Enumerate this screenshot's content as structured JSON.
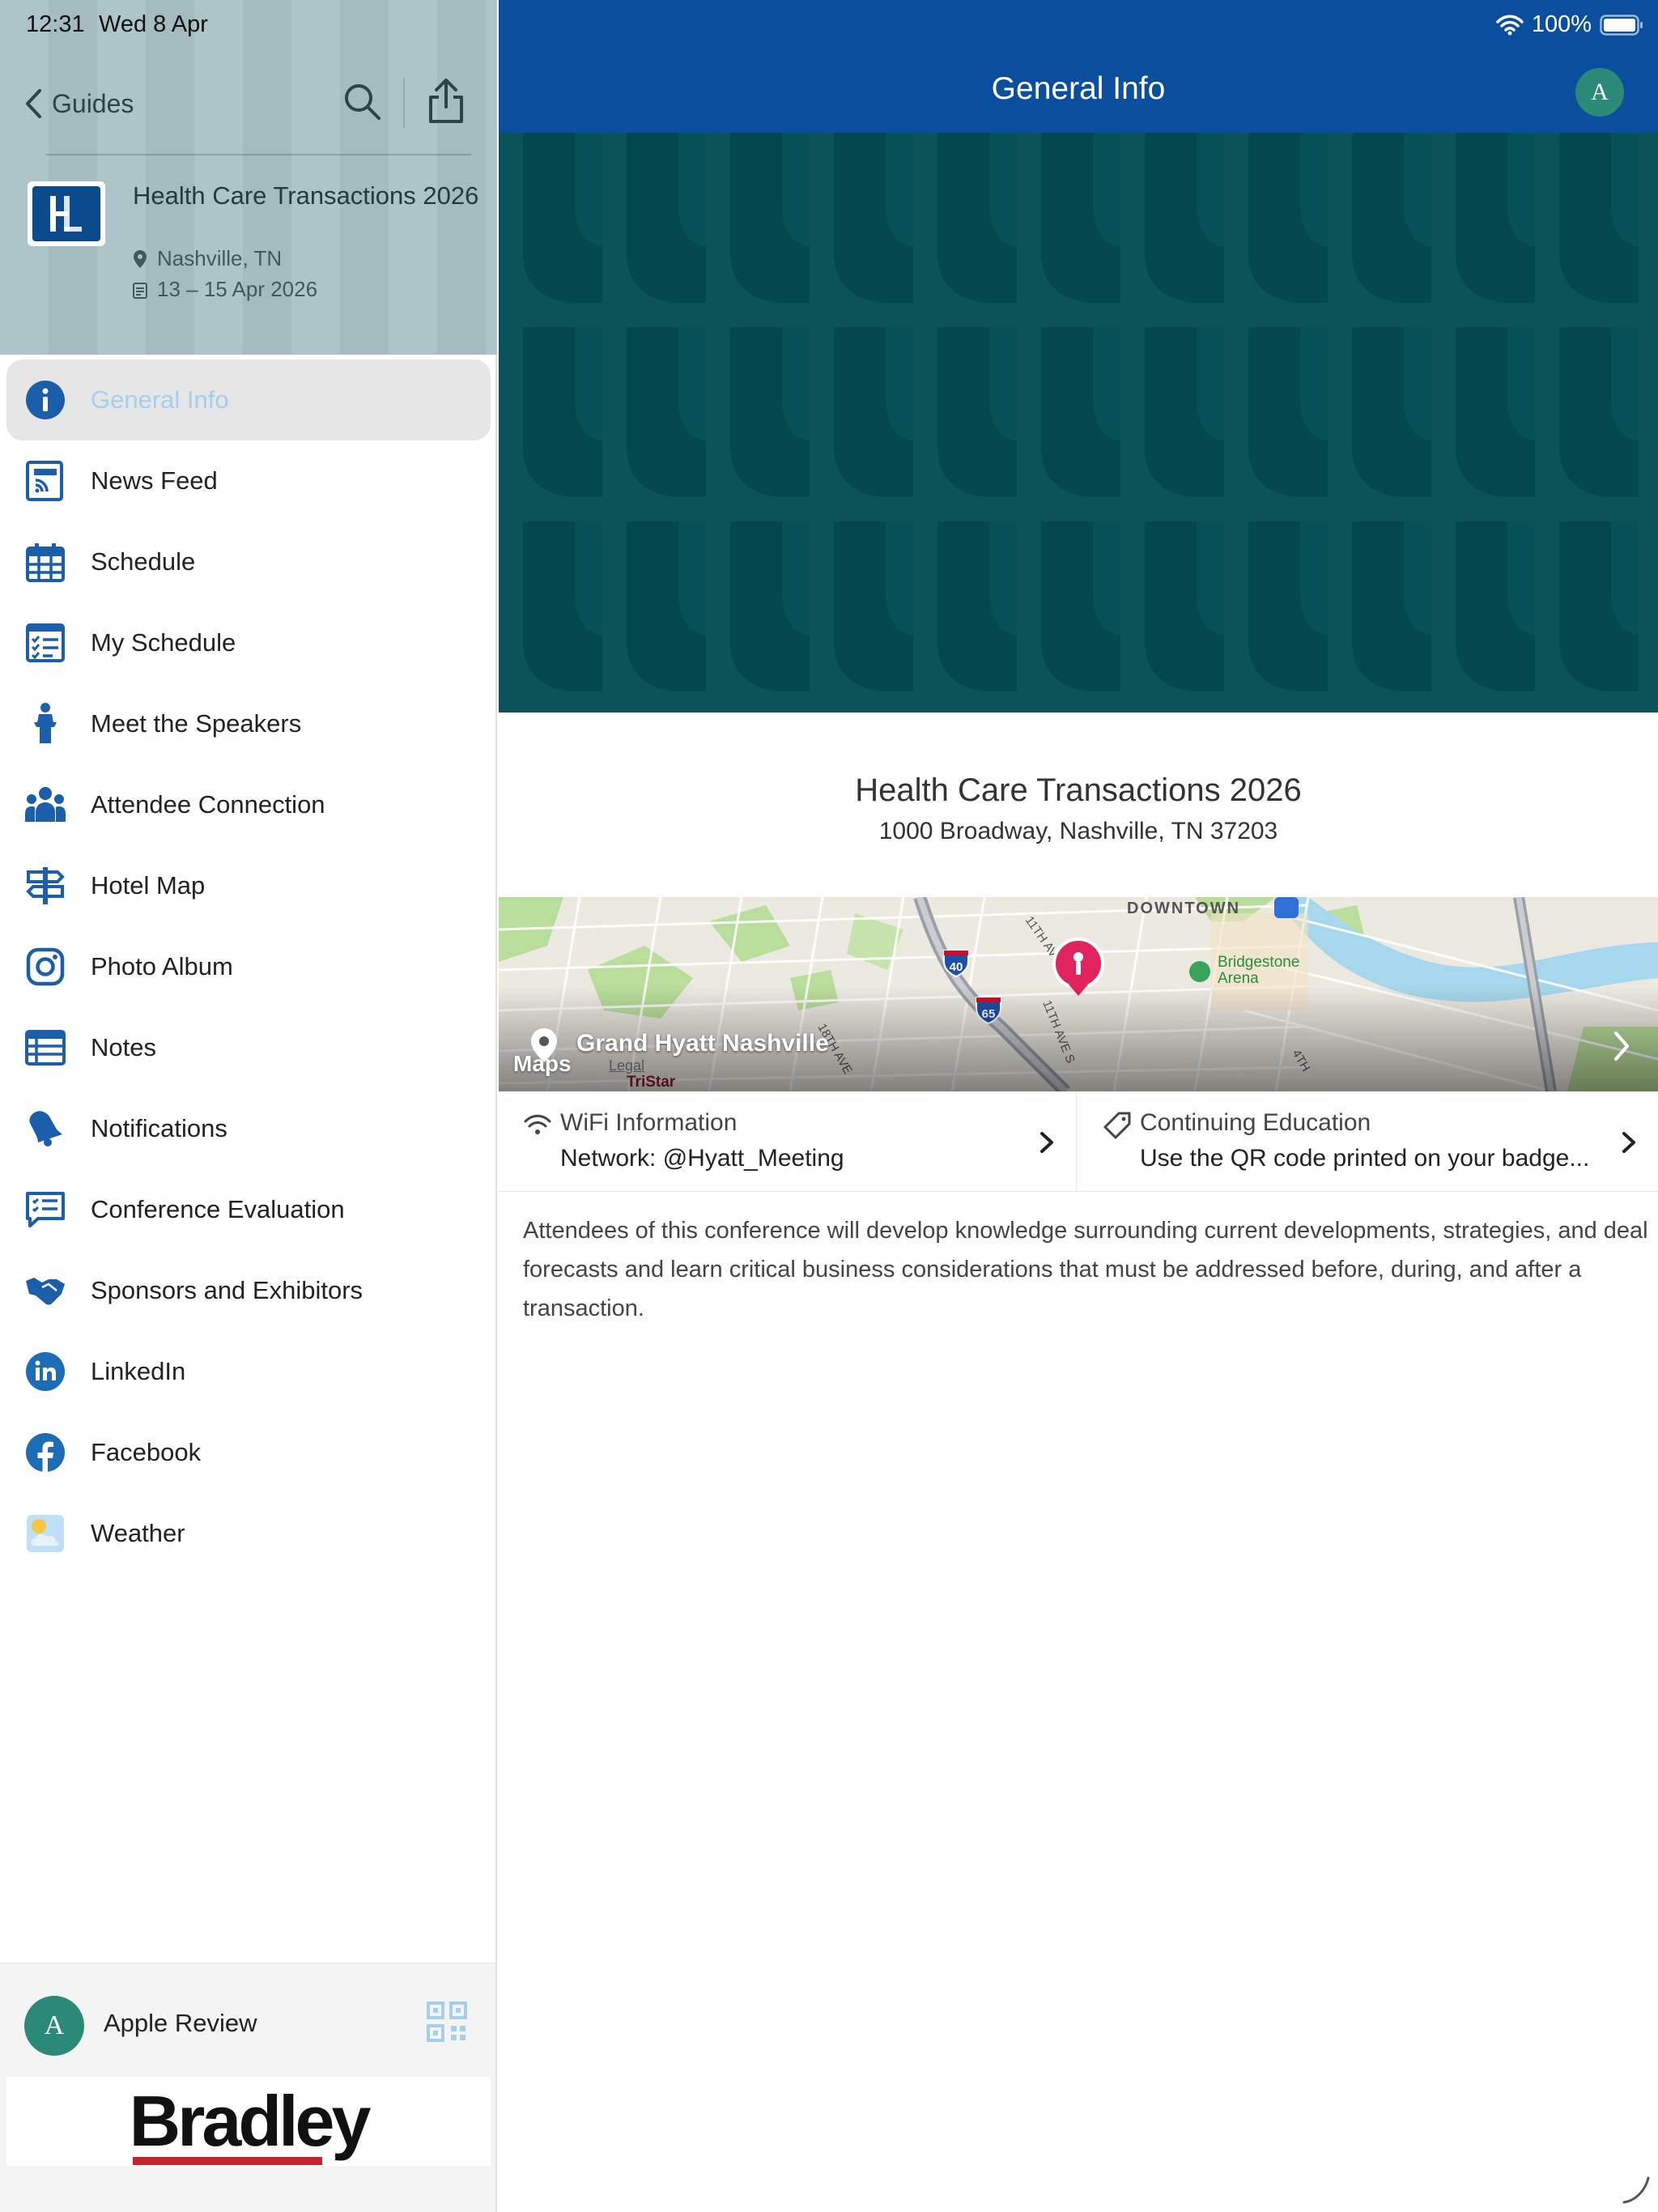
{
  "status_bar": {
    "time": "12:31",
    "date": "Wed 8 Apr",
    "battery": "100%"
  },
  "sidebar": {
    "back_label": "Guides",
    "event": {
      "title": "Health Care Transactions 2026",
      "location": "Nashville, TN",
      "dates": "13 – 15 Apr 2026",
      "logo_text": "HL"
    },
    "items": [
      {
        "label": "General Info",
        "icon": "info-icon",
        "active": true
      },
      {
        "label": "News Feed",
        "icon": "news-feed-icon"
      },
      {
        "label": "Schedule",
        "icon": "calendar-icon"
      },
      {
        "label": "My Schedule",
        "icon": "checklist-icon"
      },
      {
        "label": "Meet the Speakers",
        "icon": "speaker-podium-icon"
      },
      {
        "label": "Attendee Connection",
        "icon": "people-icon"
      },
      {
        "label": "Hotel Map",
        "icon": "signpost-icon"
      },
      {
        "label": "Photo Album",
        "icon": "instagram-icon"
      },
      {
        "label": "Notes",
        "icon": "notes-icon"
      },
      {
        "label": "Notifications",
        "icon": "bell-icon"
      },
      {
        "label": "Conference Evaluation",
        "icon": "evaluation-icon"
      },
      {
        "label": "Sponsors and Exhibitors",
        "icon": "handshake-icon"
      },
      {
        "label": "LinkedIn",
        "icon": "linkedin-icon"
      },
      {
        "label": "Facebook",
        "icon": "facebook-icon"
      },
      {
        "label": "Weather",
        "icon": "weather-icon"
      }
    ],
    "footer": {
      "user_initial": "A",
      "user_name": "Apple Review",
      "sponsor": "Bradley"
    }
  },
  "main": {
    "title": "General Info",
    "profile_initial": "A",
    "event_name": "Health Care Transactions 2026",
    "address": "1000 Broadway, Nashville, TN 37203",
    "map": {
      "venue": "Grand Hyatt Nashville",
      "credit": "Maps",
      "legal": "Legal",
      "labels": [
        "DOWNTOWN",
        "Bridgestone",
        "Arena",
        "11TH AVE N",
        "11TH AVE S",
        "18TH AVE",
        "4TH",
        "TriStar",
        "40",
        "65"
      ]
    },
    "wifi": {
      "title": "WiFi Information",
      "value": "Network: @Hyatt_Meeting"
    },
    "continuing_education": {
      "title": "Continuing Education",
      "value": "Use the QR code printed on your badge..."
    },
    "description": "Attendees of this conference will develop knowledge surrounding current developments, strategies, and deal forecasts and learn critical business considerations that must be addressed before, during, and after a transaction."
  },
  "colors": {
    "brand_blue": "#0a4f9e",
    "icon_blue": "#1b5faa",
    "hero_teal": "#03484f",
    "sidebar_header": "#a9c2c6",
    "active_label": "#a6cfee",
    "avatar_green": "#2b8a77",
    "sponsor_red": "#c3262e"
  }
}
